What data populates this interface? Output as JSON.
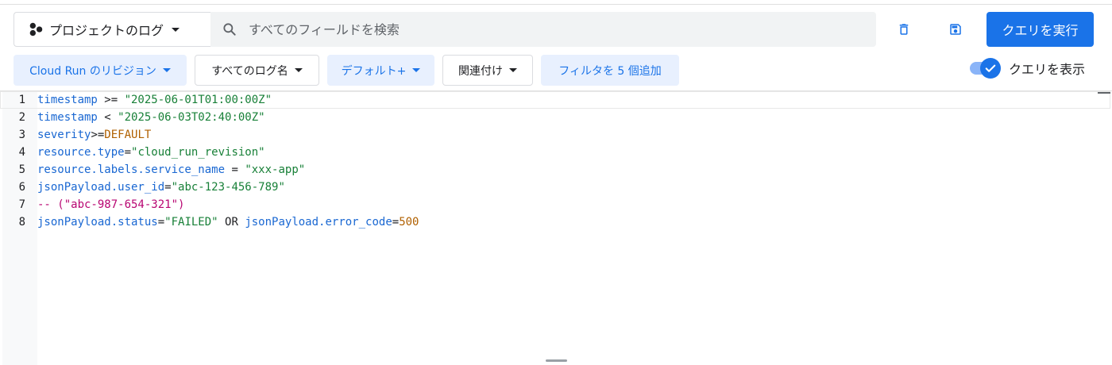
{
  "toolbar": {
    "scope_label": "プロジェクトのログ",
    "search_placeholder": "すべてのフィールドを検索",
    "run_label": "クエリを実行"
  },
  "chips": [
    {
      "label": "Cloud Run のリビジョン"
    },
    {
      "label": "すべてのログ名"
    },
    {
      "label": "デフォルト+"
    },
    {
      "label": "関連付け"
    },
    {
      "label": "フィルタを 5 個追加"
    }
  ],
  "toggle": {
    "label": "クエリを表示",
    "on": true
  },
  "editor": {
    "lines": [
      {
        "n": "1",
        "t": [
          [
            "field",
            "timestamp"
          ],
          [
            "op",
            " >= "
          ],
          [
            "str",
            "\"2025-06-01T01:00:00Z\""
          ]
        ]
      },
      {
        "n": "2",
        "t": [
          [
            "field",
            "timestamp"
          ],
          [
            "op",
            " < "
          ],
          [
            "str",
            "\"2025-06-03T02:40:00Z\""
          ]
        ]
      },
      {
        "n": "3",
        "t": [
          [
            "field",
            "severity"
          ],
          [
            "op",
            ">="
          ],
          [
            "const",
            "DEFAULT"
          ]
        ]
      },
      {
        "n": "4",
        "t": [
          [
            "field",
            "resource.type"
          ],
          [
            "op",
            "="
          ],
          [
            "str",
            "\"cloud_run_revision\""
          ]
        ]
      },
      {
        "n": "5",
        "t": [
          [
            "field",
            "resource.labels.service_name"
          ],
          [
            "op",
            " = "
          ],
          [
            "str",
            "\"xxx-app\""
          ]
        ]
      },
      {
        "n": "6",
        "t": [
          [
            "field",
            "jsonPayload.user_id"
          ],
          [
            "op",
            "="
          ],
          [
            "str",
            "\"abc-123-456-789\""
          ]
        ]
      },
      {
        "n": "7",
        "t": [
          [
            "comment",
            "-- (\"abc-987-654-321\")"
          ]
        ]
      },
      {
        "n": "8",
        "t": [
          [
            "field",
            "jsonPayload.status"
          ],
          [
            "op",
            "="
          ],
          [
            "str",
            "\"FAILED\""
          ],
          [
            "kw",
            " OR "
          ],
          [
            "field",
            "jsonPayload.error_code"
          ],
          [
            "op",
            "="
          ],
          [
            "const",
            "500"
          ]
        ]
      }
    ]
  },
  "colors": {
    "accent": "#1a73e8",
    "chip_bg": "#e8f0fe"
  },
  "icons": [
    "scope-icon",
    "search-icon",
    "trash-icon",
    "save-icon",
    "check-icon"
  ]
}
